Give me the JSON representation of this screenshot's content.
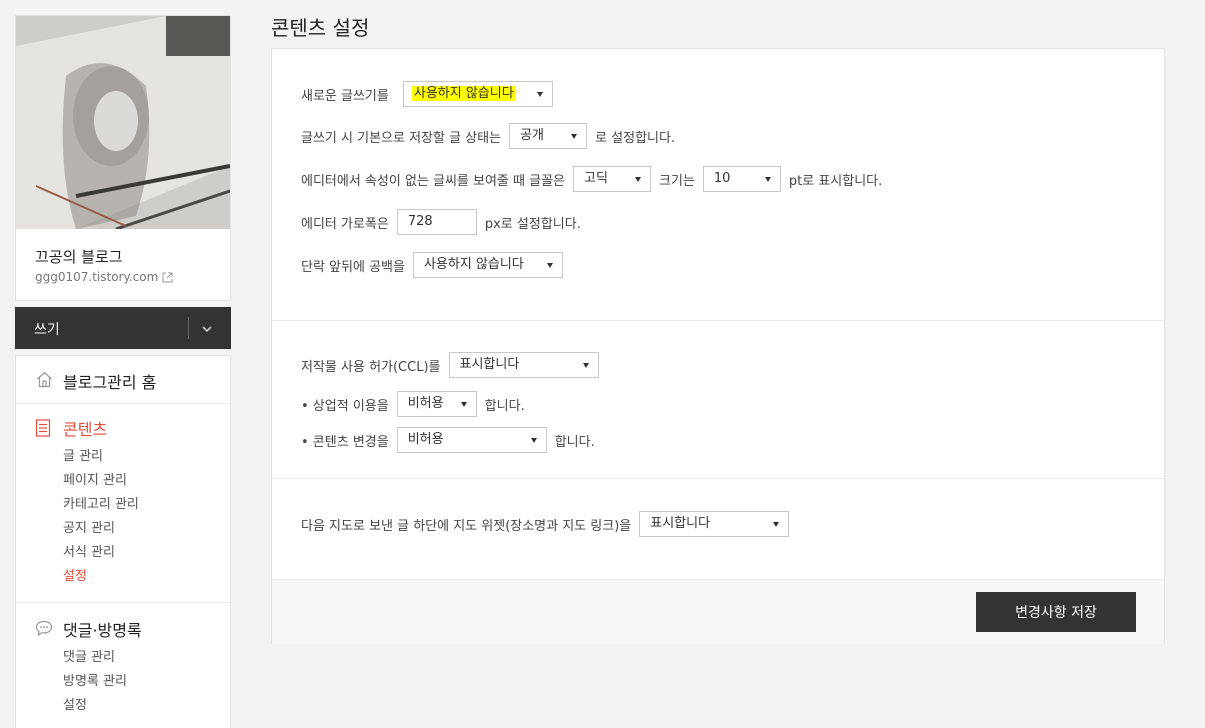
{
  "sidebar": {
    "blog_title": "끄공의 블로그",
    "blog_url": "ggg0107.tistory.com",
    "write_label": "쓰기",
    "home_label": "블로그관리 홈",
    "sections": {
      "contents": {
        "title": "콘텐츠",
        "items": [
          "글 관리",
          "페이지 관리",
          "카테고리 관리",
          "공지 관리",
          "서식 관리",
          "설정"
        ]
      },
      "comments": {
        "title": "댓글·방명록",
        "items": [
          "댓글 관리",
          "방명록 관리",
          "설정"
        ]
      }
    }
  },
  "page_title": "콘텐츠 설정",
  "settings": {
    "new_editor": {
      "label": "새로운 글쓰기를",
      "value": "사용하지 않습니다"
    },
    "default_status": {
      "label": "글쓰기 시 기본으로 저장할 글 상태는",
      "value": "공개",
      "suffix": "로 설정합니다."
    },
    "font": {
      "label": "에디터에서 속성이 없는 글씨를 보여줄 때 글꼴은",
      "value": "고딕",
      "size_label": "크기는",
      "size_value": "10",
      "suffix": "pt로 표시합니다."
    },
    "editor_width": {
      "label": "에디터 가로폭은",
      "value": "728",
      "suffix": "px로 설정합니다."
    },
    "paragraph_space": {
      "label": "단락 앞뒤에 공백을",
      "value": "사용하지 않습니다"
    },
    "ccl": {
      "label": "저작물 사용 허가(CCL)를",
      "value": "표시합니다"
    },
    "commercial": {
      "label": "• 상업적 이용을",
      "value": "비허용",
      "suffix": "합니다."
    },
    "modify": {
      "label": "• 콘텐츠 변경을",
      "value": "비허용",
      "suffix": "합니다."
    },
    "map_widget": {
      "label": "다음 지도로 보낸 글 하단에 지도 위젯(장소명과 지도 링크)을",
      "value": "표시합니다"
    }
  },
  "save_button": "변경사항 저장",
  "colors": {
    "accent": "#e44d3a",
    "dark": "#333333",
    "highlight": "#ffff00"
  }
}
